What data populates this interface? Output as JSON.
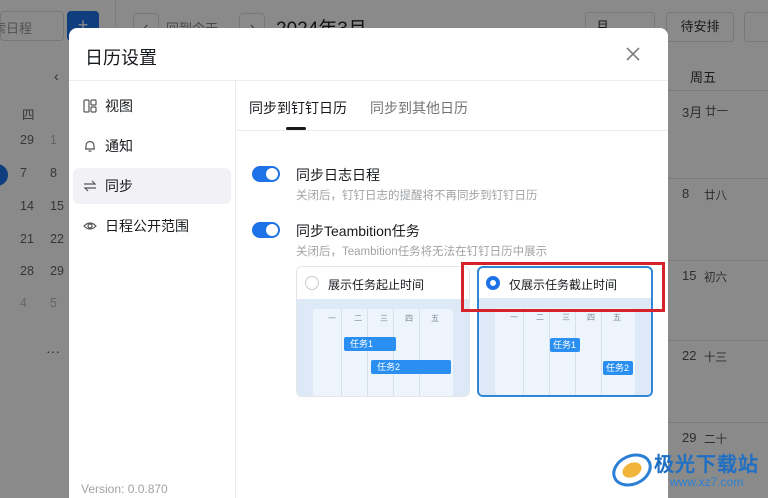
{
  "background": {
    "search_placeholder": "搜索日程",
    "back_today": "回到今天",
    "month_title": "2024年3月",
    "view_select": "月",
    "pending_button": "待安排",
    "weekday_friday": "周五",
    "mini_cal_header": "四",
    "mini_days_col1": [
      "29",
      "7",
      "14",
      "21",
      "28",
      "4"
    ],
    "mini_days_col2": [
      "1",
      "8",
      "15",
      "22",
      "29",
      "5"
    ],
    "mini_days_col0": [
      "",
      "",
      "",
      "",
      "",
      ""
    ],
    "mini_more": "···",
    "cal_cells": [
      {
        "day": "3月",
        "lunar": "廿一"
      },
      {
        "day": "8",
        "lunar": "廿八"
      },
      {
        "day": "15",
        "lunar": "初六"
      },
      {
        "day": "22",
        "lunar": "十三"
      },
      {
        "day": "29",
        "lunar": "二十"
      }
    ]
  },
  "dialog": {
    "title": "日历设置",
    "nav": [
      {
        "label": "视图",
        "icon": "view-icon"
      },
      {
        "label": "通知",
        "icon": "bell-icon"
      },
      {
        "label": "同步",
        "icon": "sync-icon"
      },
      {
        "label": "日程公开范围",
        "icon": "eye-icon"
      }
    ],
    "version": "Version: 0.0.870",
    "tabs": [
      "同步到钉钉日历",
      "同步到其他日历"
    ],
    "settings": [
      {
        "title": "同步日志日程",
        "desc": "关闭后，钉钉日志的提醒将不再同步到钉钉日历",
        "enabled": true
      },
      {
        "title": "同步Teambition任务",
        "desc": "关闭后，Teambition任务将无法在钉钉日历中展示",
        "enabled": true
      }
    ],
    "options": [
      {
        "label": "展示任务起止时间",
        "selected": false
      },
      {
        "label": "仅展示任务截止时间",
        "selected": true
      }
    ],
    "preview_headers": [
      "一",
      "二",
      "三",
      "四",
      "五"
    ],
    "preview_tasks": [
      "任务1",
      "任务2"
    ]
  },
  "watermark": {
    "name": "极光下载站",
    "url": "www.xz7.com"
  },
  "colors": {
    "accent": "#1e72e8",
    "highlight_box": "#d6222a",
    "selected_border": "#2e86d6"
  }
}
